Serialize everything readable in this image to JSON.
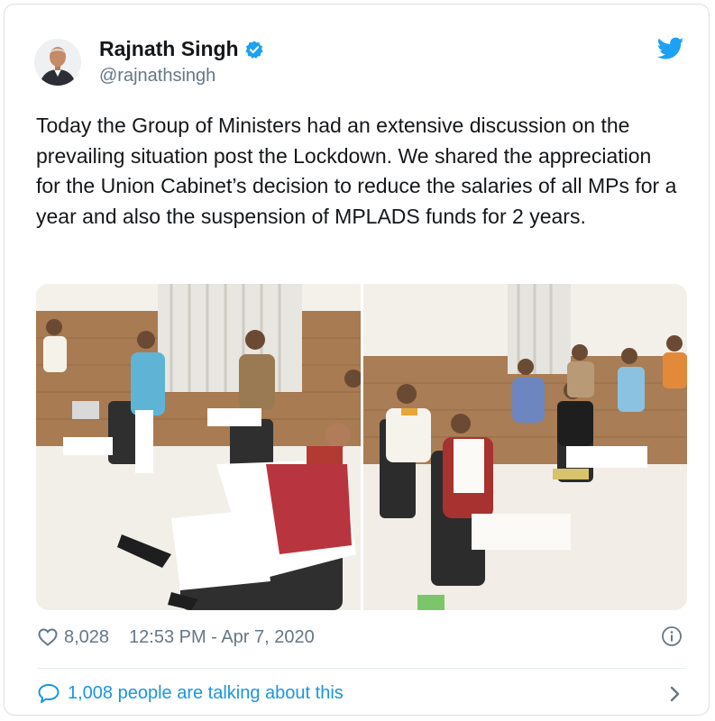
{
  "author": {
    "name": "Rajnath Singh",
    "handle": "@rajnathsingh",
    "verified": true
  },
  "icons": {
    "avatar": "profile-photo",
    "verified": "verified-badge-icon",
    "brand": "twitter-bird-icon",
    "like": "heart-icon",
    "info": "info-icon",
    "talk": "speech-bubble-icon",
    "more": "chevron-right-icon"
  },
  "tweet": {
    "text": "Today the Group of Ministers had an extensive discussion on the prevailing situation post the Lockdown. We shared the appreciation for the Union Cabinet’s decision to reduce the salaries of all MPs for a year and also the suspension of MPLADS funds for 2 years.",
    "likes": "8,028",
    "timestamp": "12:53 PM - Apr 7, 2020",
    "talking": "1,008 people are talking about this"
  },
  "colors": {
    "brand": "#1da1f2",
    "link": "#1b95e0",
    "muted": "#657786",
    "text": "#14171a"
  }
}
